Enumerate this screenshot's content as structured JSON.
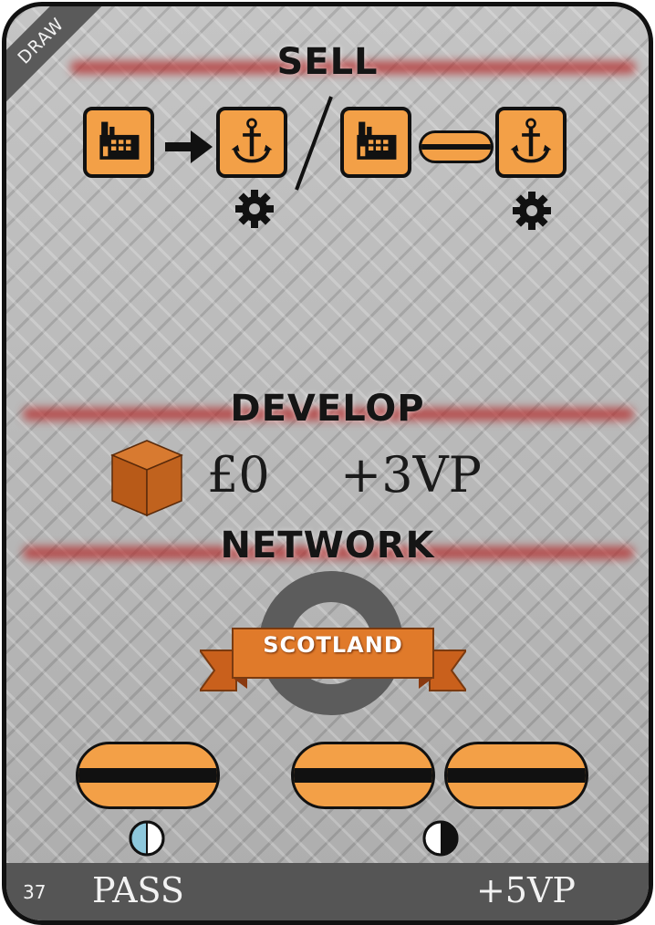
{
  "card": {
    "corner_label": "DRAW",
    "sell": {
      "heading": "SELL"
    },
    "develop": {
      "heading": "DEVELOP",
      "cost": "£0",
      "reward": "+3VP"
    },
    "network": {
      "heading": "NETWORK",
      "location": "SCOTLAND"
    },
    "footer": {
      "number": "37",
      "pass": "PASS",
      "reward": "+5VP"
    },
    "colors": {
      "tile": "#f3a047",
      "stripe": "#b42828",
      "cube": "#c0621e",
      "banner": "#e07a2a",
      "half_circle_blue": "#8ec8dc"
    },
    "icons": [
      "factory-icon",
      "arrow-right-icon",
      "anchor-icon",
      "gear-icon",
      "slash-icon",
      "link-icon",
      "cube-icon",
      "ring-icon",
      "banner-icon",
      "half-circle-icon"
    ]
  }
}
